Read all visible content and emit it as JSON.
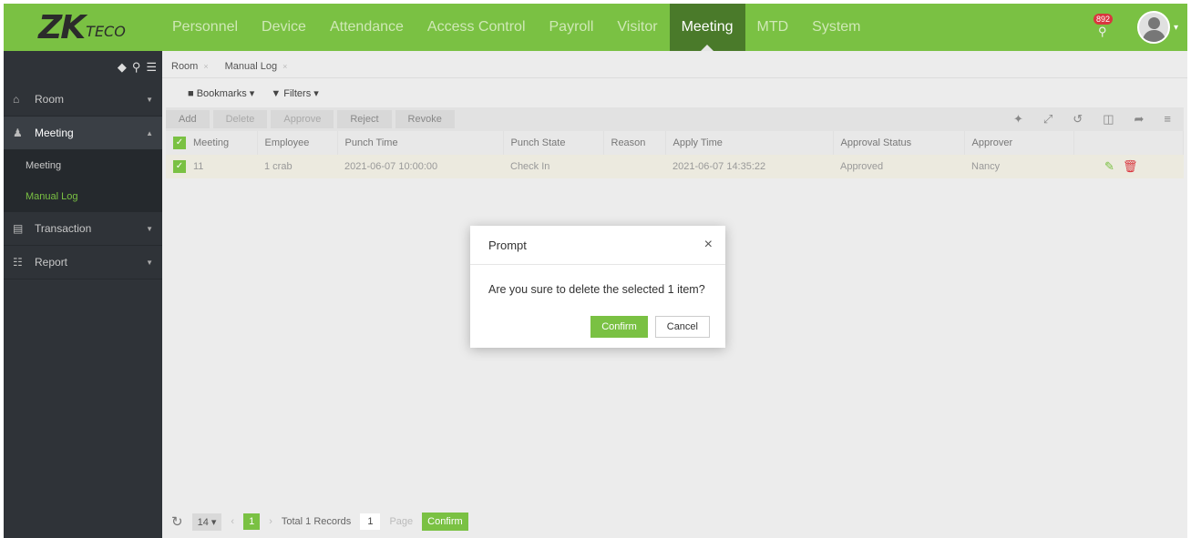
{
  "brand": {
    "logo_main": "ZK",
    "logo_sub": "TECO",
    "accent": "#7ac143"
  },
  "nav": {
    "items": [
      {
        "label": "Personnel"
      },
      {
        "label": "Device"
      },
      {
        "label": "Attendance"
      },
      {
        "label": "Access Control"
      },
      {
        "label": "Payroll"
      },
      {
        "label": "Visitor"
      },
      {
        "label": "Meeting",
        "active": true
      },
      {
        "label": "MTD"
      },
      {
        "label": "System"
      }
    ],
    "notification_count": "892"
  },
  "sidebar": {
    "groups": [
      {
        "icon": "home-icon",
        "label": "Room"
      },
      {
        "icon": "users-icon",
        "label": "Meeting",
        "subitems": [
          {
            "label": "Meeting"
          },
          {
            "label": "Manual Log",
            "active": true
          }
        ]
      },
      {
        "icon": "database-icon",
        "label": "Transaction"
      },
      {
        "icon": "report-icon",
        "label": "Report"
      }
    ]
  },
  "tabs": [
    {
      "label": "Room"
    },
    {
      "label": "Manual Log"
    }
  ],
  "filters": {
    "bookmarks": "Bookmarks",
    "filters": "Filters"
  },
  "toolbar": {
    "add": "Add",
    "delete": "Delete",
    "approve": "Approve",
    "reject": "Reject",
    "revoke": "Revoke"
  },
  "table": {
    "headers": [
      "Meeting",
      "Employee",
      "Punch Time",
      "Punch State",
      "Reason",
      "Apply Time",
      "Approval Status",
      "Approver"
    ],
    "rows": [
      {
        "meeting": "11",
        "employee": "1 crab",
        "punch_time": "2021-06-07 10:00:00",
        "punch_state": "Check In",
        "reason": "",
        "apply_time": "2021-06-07 14:35:22",
        "approval_status": "Approved",
        "approver": "Nancy"
      }
    ]
  },
  "pager": {
    "page_size": "14",
    "current_page": "1",
    "total": "Total 1 Records",
    "page_input": "1",
    "page_label": "Page",
    "confirm": "Confirm"
  },
  "dialog": {
    "title": "Prompt",
    "message": "Are you sure to delete the selected 1 item?",
    "confirm": "Confirm",
    "cancel": "Cancel"
  }
}
